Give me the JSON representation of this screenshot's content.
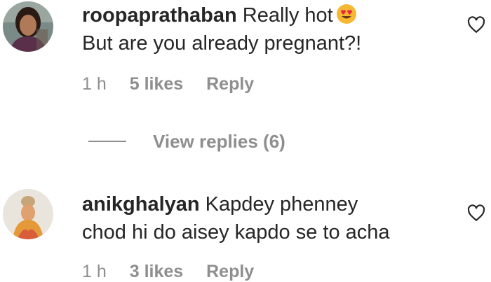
{
  "comments": [
    {
      "username": "roopaprathaban",
      "text_line1": "Really hot",
      "text_line2": "But are you already pregnant?!",
      "emoji_icon": "heart-eyes-emoji",
      "time": "1 h",
      "likes": "5 likes",
      "reply_label": "Reply"
    },
    {
      "username": "anikghalyan",
      "text_line1": "Kapdey phenney",
      "text_line2": "chod hi do aisey kapdo se to acha",
      "time": "1 h",
      "likes": "3 likes",
      "reply_label": "Reply"
    }
  ],
  "view_replies_label": "View replies (6)",
  "colors": {
    "text": "#262626",
    "secondary": "#8e8e8e",
    "background": "#ffffff"
  },
  "icons": [
    "heart-outline-icon",
    "heart-eyes-emoji",
    "avatar"
  ]
}
